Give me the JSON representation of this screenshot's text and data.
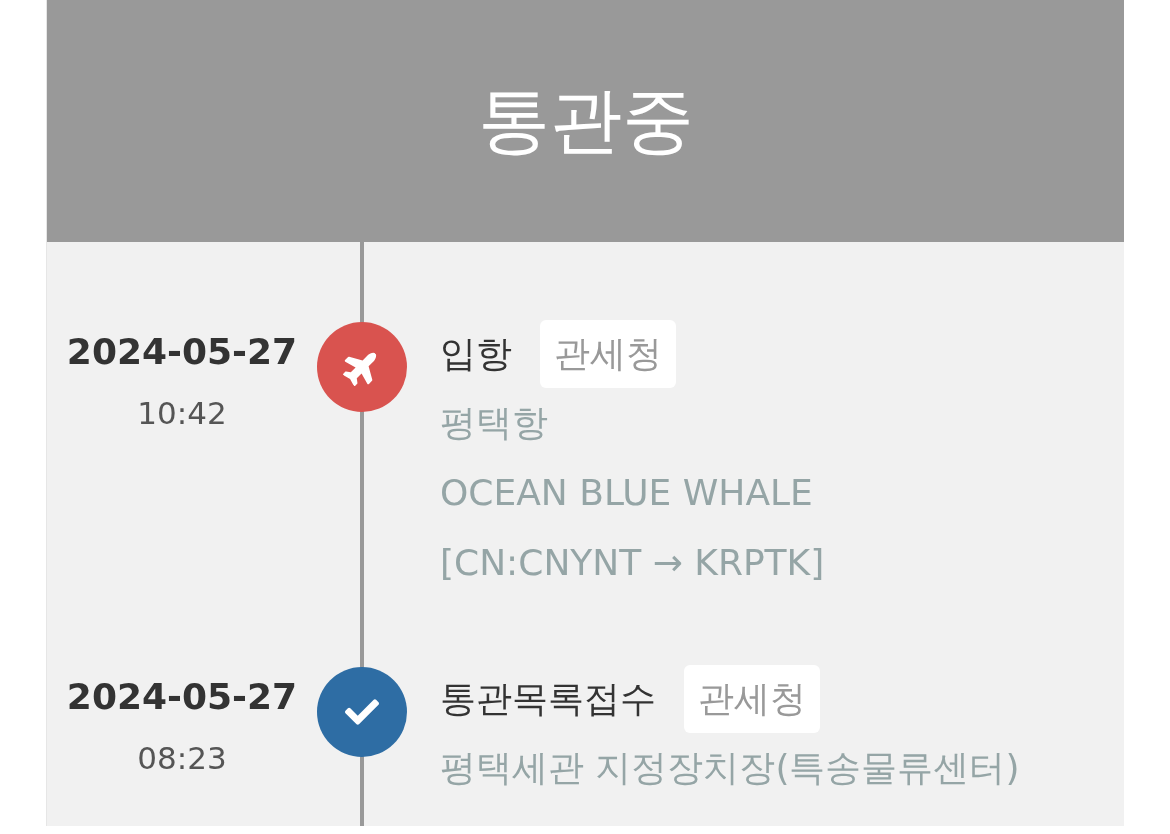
{
  "header": {
    "status": "통관중"
  },
  "events": [
    {
      "date": "2024-05-27",
      "time": "10:42",
      "kind": "plane",
      "color": "#d9534f",
      "title": "입항",
      "agency": "관세청",
      "details": [
        "평택항",
        "OCEAN BLUE WHALE",
        "[CN:CNYNT → KRPTK]"
      ]
    },
    {
      "date": "2024-05-27",
      "time": "08:23",
      "kind": "check",
      "color": "#2e6da4",
      "title": "통관목록접수",
      "agency": "관세청",
      "details": [
        "평택세관 지정장치장(특송물류센터)"
      ]
    }
  ]
}
